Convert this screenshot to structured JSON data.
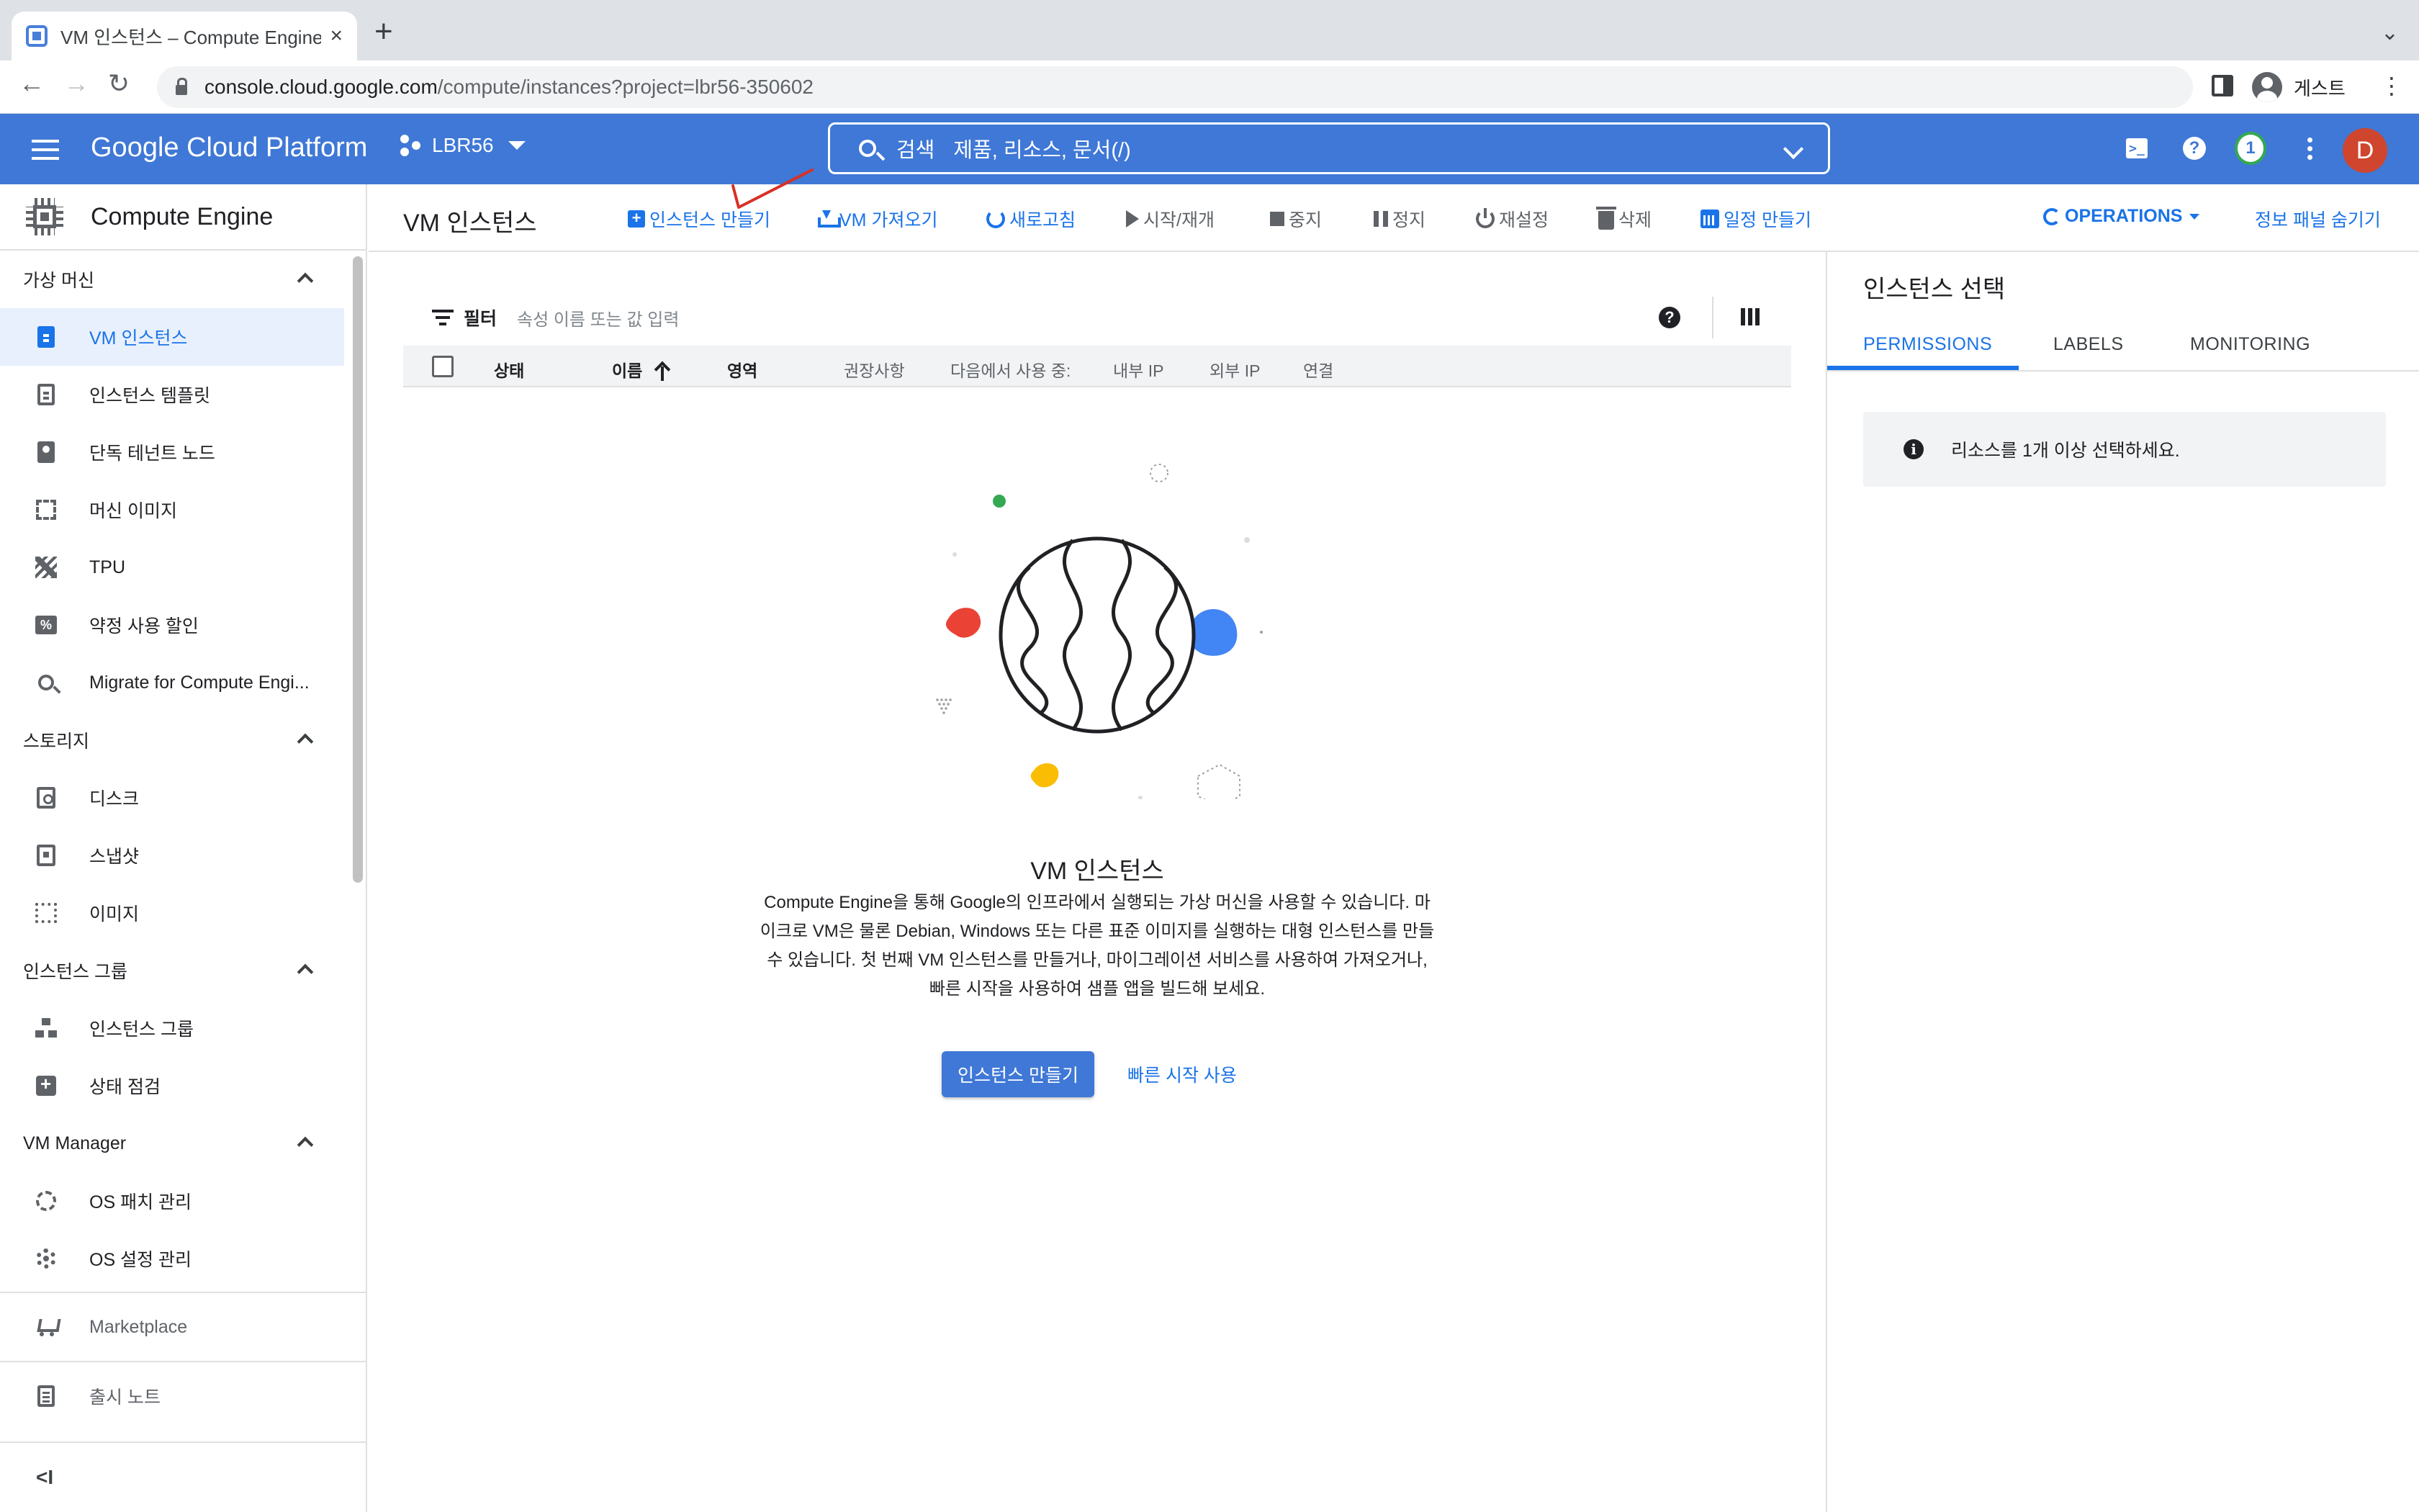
{
  "browser": {
    "tab_title": "VM 인스턴스 – Compute Engine",
    "tab_close": "×",
    "new_tab": "+",
    "tab_menu": "⌄",
    "back": "←",
    "forward": "→",
    "reload": "↻",
    "url_host": "console.cloud.google.com",
    "url_path": "/compute/instances?project=lbr56-350602",
    "profile_label": "게스트",
    "menu": "⋮"
  },
  "gcp": {
    "product_title": "Google Cloud Platform",
    "project_name": "LBR56",
    "search_label": "검색",
    "search_placeholder": "제품, 리소스, 문서(/)",
    "shell_icon_text": ">_",
    "help_icon_text": "?",
    "notification_count": "1",
    "user_initial": "D"
  },
  "sidebar": {
    "title": "Compute Engine",
    "sections": [
      {
        "label": "가상 머신"
      },
      {
        "label": "스토리지"
      },
      {
        "label": "인스턴스 그룹"
      },
      {
        "label": "VM Manager"
      }
    ],
    "items": [
      {
        "label": "VM 인스턴스"
      },
      {
        "label": "인스턴스 템플릿"
      },
      {
        "label": "단독 테넌트 노드"
      },
      {
        "label": "머신 이미지"
      },
      {
        "label": "TPU"
      },
      {
        "label": "약정 사용 할인"
      },
      {
        "label": "Migrate for Compute Engi..."
      },
      {
        "label": "디스크"
      },
      {
        "label": "스냅샷"
      },
      {
        "label": "이미지"
      },
      {
        "label": "인스턴스 그룹"
      },
      {
        "label": "상태 점검"
      },
      {
        "label": "OS 패치 관리"
      },
      {
        "label": "OS 설정 관리"
      }
    ],
    "marketplace": "Marketplace",
    "release_notes": "출시 노트",
    "percent_icon_text": "%",
    "collapse_label": "<I"
  },
  "toolbar": {
    "page_title": "VM 인스턴스",
    "create_instance": "인스턴스 만들기",
    "import_vm": "VM 가져오기",
    "refresh": "새로고침",
    "start_resume": "시작/재개",
    "stop": "중지",
    "suspend": "정지",
    "reset": "재설정",
    "delete": "삭제",
    "create_schedule": "일정 만들기",
    "operations": "OPERATIONS",
    "hide_info_panel": "정보 패널 숨기기",
    "add_glyph": "+"
  },
  "table": {
    "filter_label": "필터",
    "filter_placeholder": "속성 이름 또는 값 입력",
    "help_text": "?",
    "columns": [
      "상태",
      "이름",
      "영역",
      "권장사항",
      "다음에서 사용 중:",
      "내부 IP",
      "외부 IP",
      "연결"
    ]
  },
  "empty_state": {
    "title": "VM 인스턴스",
    "description": "Compute Engine을 통해 Google의 인프라에서 실행되는 가상 머신을 사용할 수 있습니다. 마이크로 VM은 물론 Debian, Windows 또는 다른 표준 이미지를 실행하는 대형 인스턴스를 만들 수 있습니다. 첫 번째 VM 인스턴스를 만들거나, 마이그레이션 서비스를 사용하여 가져오거나, 빠른 시작을 사용하여 샘플 앱을 빌드해 보세요.",
    "primary_button": "인스턴스 만들기",
    "secondary_link": "빠른 시작 사용"
  },
  "info_panel": {
    "title": "인스턴스 선택",
    "tabs": [
      "PERMISSIONS",
      "LABELS",
      "MONITORING"
    ],
    "active_tab": "PERMISSIONS",
    "info_icon_text": "i",
    "notice": "리소스를 1개 이상 선택하세요."
  },
  "colors": {
    "brand_blue": "#3f78d6",
    "link_blue": "#1a73e8",
    "annotation_red": "#d93025",
    "illustration_green": "#34a853",
    "illustration_red": "#ea4335",
    "illustration_yellow": "#fbbc04",
    "illustration_blue": "#4285f4"
  }
}
